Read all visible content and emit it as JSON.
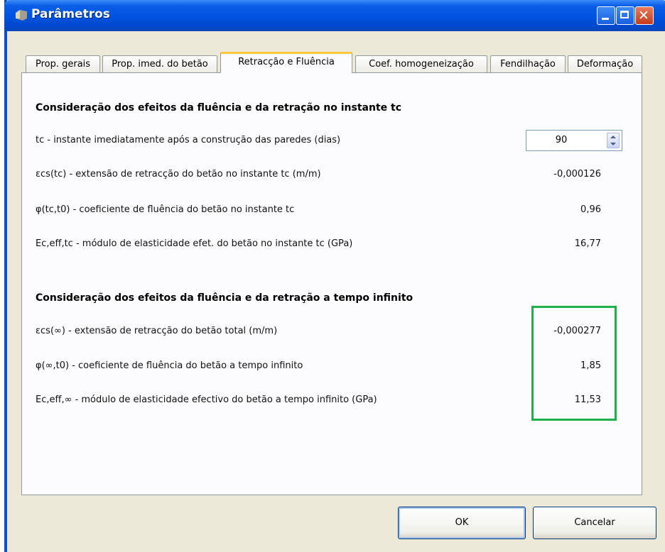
{
  "window": {
    "title": "Parâmetros"
  },
  "tabs": [
    {
      "label": "Prop. gerais"
    },
    {
      "label": "Prop. imed. do betão"
    },
    {
      "label": "Retracção e Fluência"
    },
    {
      "label": "Coef. homogeneização"
    },
    {
      "label": "Fendilhação"
    },
    {
      "label": "Deformação"
    }
  ],
  "active_tab": "Retracção e Fluência",
  "section1": {
    "heading": "Consideração dos efeitos da fluência e da retração no instante tc",
    "tc": {
      "label": "tc - instante imediatamente após a construção das paredes (dias)",
      "value": "90"
    },
    "rows": [
      {
        "label": "εcs(tc) - extensão de retracção do betão no instante tc (m/m)",
        "value": "-0,000126"
      },
      {
        "label": "φ(tc,t0) - coeficiente de fluência do betão no instante tc",
        "value": "0,96"
      },
      {
        "label": "Ec,eff,tc - módulo de elasticidade efet. do betão no instante tc (GPa)",
        "value": "16,77"
      }
    ]
  },
  "section2": {
    "heading": "Consideração dos efeitos da fluência e da retração a tempo infinito",
    "rows": [
      {
        "label": "εcs(∞) - extensão de retracção do betão total (m/m)",
        "value": "-0,000277"
      },
      {
        "label": "φ(∞,t0) - coeficiente de fluência do betão a tempo infinito",
        "value": "1,85"
      },
      {
        "label": "Ec,eff,∞ - módulo de elasticidade efectivo do betão a tempo infinito (GPa)",
        "value": "11,53"
      }
    ]
  },
  "buttons": {
    "ok": "OK",
    "cancel": "Cancelar"
  },
  "colors": {
    "titlebar": "#0254e0",
    "highlight": "#20b04b",
    "tab_accent": "#ffc83c"
  },
  "icons": {
    "window": "folder-icon",
    "minimize": "minimize-icon",
    "maximize": "maximize-icon",
    "close": "close-icon"
  }
}
